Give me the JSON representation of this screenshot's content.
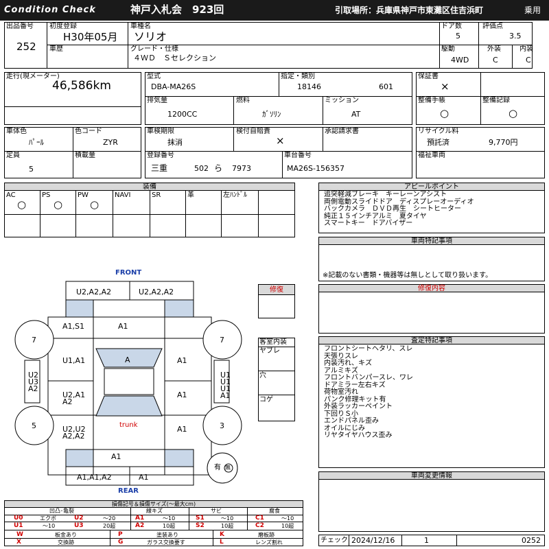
{
  "header": {
    "brand": "Condition Check",
    "auction": "神戸入札会　923回",
    "pickup": "引取場所：兵庫県神戸市東灘区住吉浜町",
    "category": "乗用"
  },
  "top": {
    "lot_label": "出品番号",
    "lot": "252",
    "first_reg_label": "初度登録",
    "first_reg": "H30年05月",
    "model_name_label": "車種名",
    "model_name": "ソリオ",
    "doors_label": "ドア数",
    "doors": "5",
    "score_label": "評価点",
    "score": "3.5",
    "history_label": "車歴",
    "grade_label": "グレード・仕様",
    "grade": "４ＷＤ　Ｓセレクション",
    "drive_label": "駆動",
    "drive": "4WD",
    "exterior_label": "外装",
    "exterior": "C",
    "interior_label": "内装",
    "interior": "C"
  },
  "mid": {
    "mileage_label": "走行(現メーター)",
    "mileage": "46,586km",
    "type_label": "型式",
    "type": "DBA-MA26S",
    "designation_label": "指定・類別",
    "designation": "18146",
    "category_no": "601",
    "warranty_label": "保証書",
    "warranty": "×",
    "displacement_label": "排気量",
    "displacement": "1200CC",
    "fuel_label": "燃料",
    "fuel": "ｶﾞｿﾘﾝ",
    "transmission_label": "ミッション",
    "transmission": "AT",
    "service_book_label": "整備手帳",
    "service_book": "○",
    "service_record_label": "整備記録",
    "service_record": "○",
    "color_label": "車体色",
    "color": "ﾊﾟｰﾙ",
    "color_code_label": "色コード",
    "color_code": "ZYR",
    "inspection_label": "車検期限",
    "inspection": "抹消",
    "liability_label": "検付自賠責",
    "liability": "×",
    "approval_label": "承認請求書",
    "recycle_label": "リサイクル料",
    "recycle_status": "預託済",
    "recycle_fee": "9,770円",
    "capacity_label": "定員",
    "capacity": "5",
    "load_label": "積載量",
    "plate_label": "登録番号",
    "plate_region": "三重",
    "plate_class": "502",
    "plate_kana": "ら",
    "plate_no": "7973",
    "chassis_label": "車台番号",
    "chassis": "MA26S-156357",
    "welfare_label": "福祉車両"
  },
  "equipment": {
    "title": "装備",
    "items": [
      {
        "label": "AC",
        "value": "○"
      },
      {
        "label": "PS",
        "value": "○"
      },
      {
        "label": "PW",
        "value": "○"
      },
      {
        "label": "NAVI",
        "value": ""
      },
      {
        "label": "SR",
        "value": ""
      },
      {
        "label": "革",
        "value": ""
      },
      {
        "label": "左ﾊﾝﾄﾞﾙ",
        "value": ""
      }
    ]
  },
  "appeal": {
    "title": "アピールポイント",
    "lines": [
      "追突軽減ブレーキ　キーレーンアシスト",
      "両側電動スライドドア　ディスプレーオーディオ",
      "バックカメラ　ＤＶＤ再生　シートヒーター",
      "純正１５インチアルミ　夏タイヤ",
      "スマートキー　ドアバイザー"
    ]
  },
  "special": {
    "title": "車両特記事項",
    "note": "※記載のない書類・機器等は無しとして取り扱います。"
  },
  "repair": {
    "title": "修復内容",
    "box_label": "修復"
  },
  "inspection": {
    "title": "査定特記事項",
    "lines": [
      "フロントシートヘタリ、スレ",
      "天張りスレ",
      "内装汚れ、キズ",
      "アルミキズ",
      "フロントバンパースレ、ワレ",
      "ドアミラー左右キズ",
      "荷物室汚れ",
      "パンク修理キット有",
      "外装ラッカーペイント",
      "下回りＳ小",
      "エンドパネル歪み",
      "オイルにじみ",
      "リヤタイヤハウス歪み"
    ]
  },
  "changes": {
    "title": "車両変更情報"
  },
  "check": {
    "label": "チェック",
    "date": "2024/12/16",
    "num": "1",
    "code": "0252"
  },
  "cabin": {
    "title": "客室内装",
    "rows": [
      "ヤブレ",
      "穴",
      "コゲ"
    ]
  },
  "diagram": {
    "front": "FRONT",
    "rear": "REAR",
    "trunk": "trunk",
    "labels": {
      "fl_bumper": "U2,A2,A2",
      "fr_bumper": "U2,A2,A2",
      "hood_l": "A1,S1",
      "hood_r": "A1",
      "windshield": "A",
      "l_front_door": "U1,A1",
      "r_front_door": "A1",
      "l_rear_door1": "U2,A1",
      "l_rear_door2": "A2",
      "r_rear_door": "A1",
      "l_quarter1": "U2,U2",
      "l_quarter2": "A2,A2",
      "r_quarter": "A1",
      "rear_panel": "A1",
      "rear_bumper_l": "A1,A1,A2",
      "rear_bumper_r": "A1",
      "l_fender_side1": "U2",
      "l_fender_side2": "U3",
      "l_fender_side3": "A2",
      "r_side1": "U1",
      "r_side2": "U1",
      "r_side3": "U1",
      "r_side4": "A1",
      "wheel_fl": "7",
      "wheel_fr": "7",
      "wheel_rl": "5",
      "wheel_rr": "3",
      "spare_yes": "有",
      "spare_no": "無"
    }
  },
  "legend": {
    "title": "損傷記号＆損傷サイズ(〜最大cm)",
    "groups": [
      "凹凸･亀裂",
      "線キズ",
      "サビ",
      "腐食"
    ],
    "rows": [
      [
        [
          "U0",
          "エクボ"
        ],
        [
          "U2",
          "〜20"
        ],
        [
          "A1",
          "〜10"
        ],
        [
          "S1",
          "〜10"
        ],
        [
          "C1",
          "〜10"
        ]
      ],
      [
        [
          "U1",
          "〜10"
        ],
        [
          "U3",
          "20超"
        ],
        [
          "A2",
          "10超"
        ],
        [
          "S2",
          "10超"
        ],
        [
          "C2",
          "10超"
        ]
      ]
    ],
    "rows2": [
      [
        [
          "W",
          "板金あり"
        ],
        [
          "P",
          "塗装あり"
        ],
        [
          "K",
          "磨板跡"
        ]
      ],
      [
        [
          "X",
          "交換跡"
        ],
        [
          "G",
          "ガラス交換要す"
        ],
        [
          "L",
          "レンズ割れ"
        ]
      ]
    ]
  },
  "colors": {
    "accent_red": "#d00000",
    "accent_blue": "#1a3ea8",
    "glass": "#c9d7e8",
    "gray": "#d9d9d9"
  }
}
